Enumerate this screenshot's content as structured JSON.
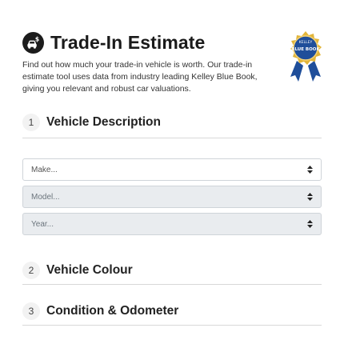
{
  "header": {
    "title": "Trade-In Estimate",
    "icon": "car-dollar-icon",
    "intro": "Find out how much your trade-in vehicle is worth. Our trade-in estimate tool uses data from industry leading Kelley Blue Book, giving you relevant and robust car valuations.",
    "badge": {
      "icon": "kelley-blue-book-badge",
      "top_text": "KELLEY",
      "main_text": "BLUE BOOK"
    }
  },
  "sections": [
    {
      "number": "1",
      "title": "Vehicle Description"
    },
    {
      "number": "2",
      "title": "Vehicle Colour"
    },
    {
      "number": "3",
      "title": "Condition & Odometer"
    }
  ],
  "selects": {
    "make": {
      "value": "Make...",
      "enabled": true
    },
    "model": {
      "value": "Model...",
      "enabled": false
    },
    "year": {
      "value": "Year...",
      "enabled": false
    }
  },
  "colors": {
    "badge_blue": "#1f4e9a",
    "badge_gold": "#e2b53a",
    "disabled_bg": "#e9ecef",
    "divider": "#d8d8d8"
  }
}
